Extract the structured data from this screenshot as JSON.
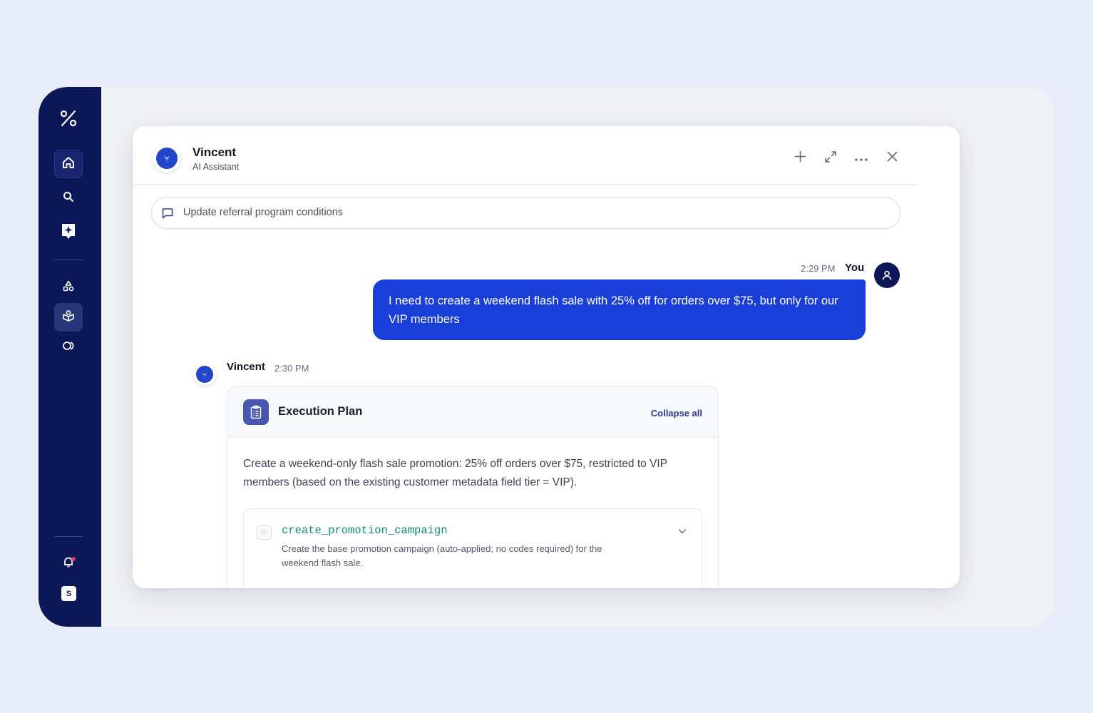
{
  "colors": {
    "page_bg": "#e9ecf9",
    "sidebar_bg": "#0c1757",
    "user_bubble": "#1a3fd8",
    "accent": "#4a57b0",
    "step_code": "#14915f",
    "notification_dot": "#e8365f"
  },
  "sidebar": {
    "logo_icon": "percent-logo-icon",
    "items": [
      {
        "icon": "home-icon",
        "active": true
      },
      {
        "icon": "search-icon"
      },
      {
        "icon": "ai-sparkle-icon"
      },
      {
        "icon": "shapes-icon"
      },
      {
        "icon": "package-icon",
        "active": true
      },
      {
        "icon": "loop-icon"
      }
    ],
    "bottom": {
      "bell_icon": "bell-icon",
      "has_notification": true,
      "avatar_initial": "S"
    }
  },
  "chat": {
    "assistant_name": "Vincent",
    "assistant_role": "AI Assistant",
    "header_actions": [
      "plus-icon",
      "expand-icon",
      "more-icon",
      "close-icon"
    ],
    "topic": "Update referral program conditions",
    "messages": {
      "user": {
        "time": "2:29 PM",
        "author": "You",
        "text": "I need to create a weekend flash sale with 25% off for orders over $75, but only for our VIP members"
      },
      "assistant": {
        "author": "Vincent",
        "time": "2:30 PM"
      }
    },
    "plan": {
      "title": "Execution Plan",
      "collapse_label": "Collapse all",
      "description": "Create a weekend-only flash sale promotion: 25% off orders over $75, restricted to VIP members (based on the existing customer metadata field tier = VIP).",
      "steps": [
        {
          "name": "create_promotion_campaign",
          "description": "Create the base promotion campaign (auto-applied; no codes required) for the weekend flash sale."
        }
      ]
    }
  }
}
